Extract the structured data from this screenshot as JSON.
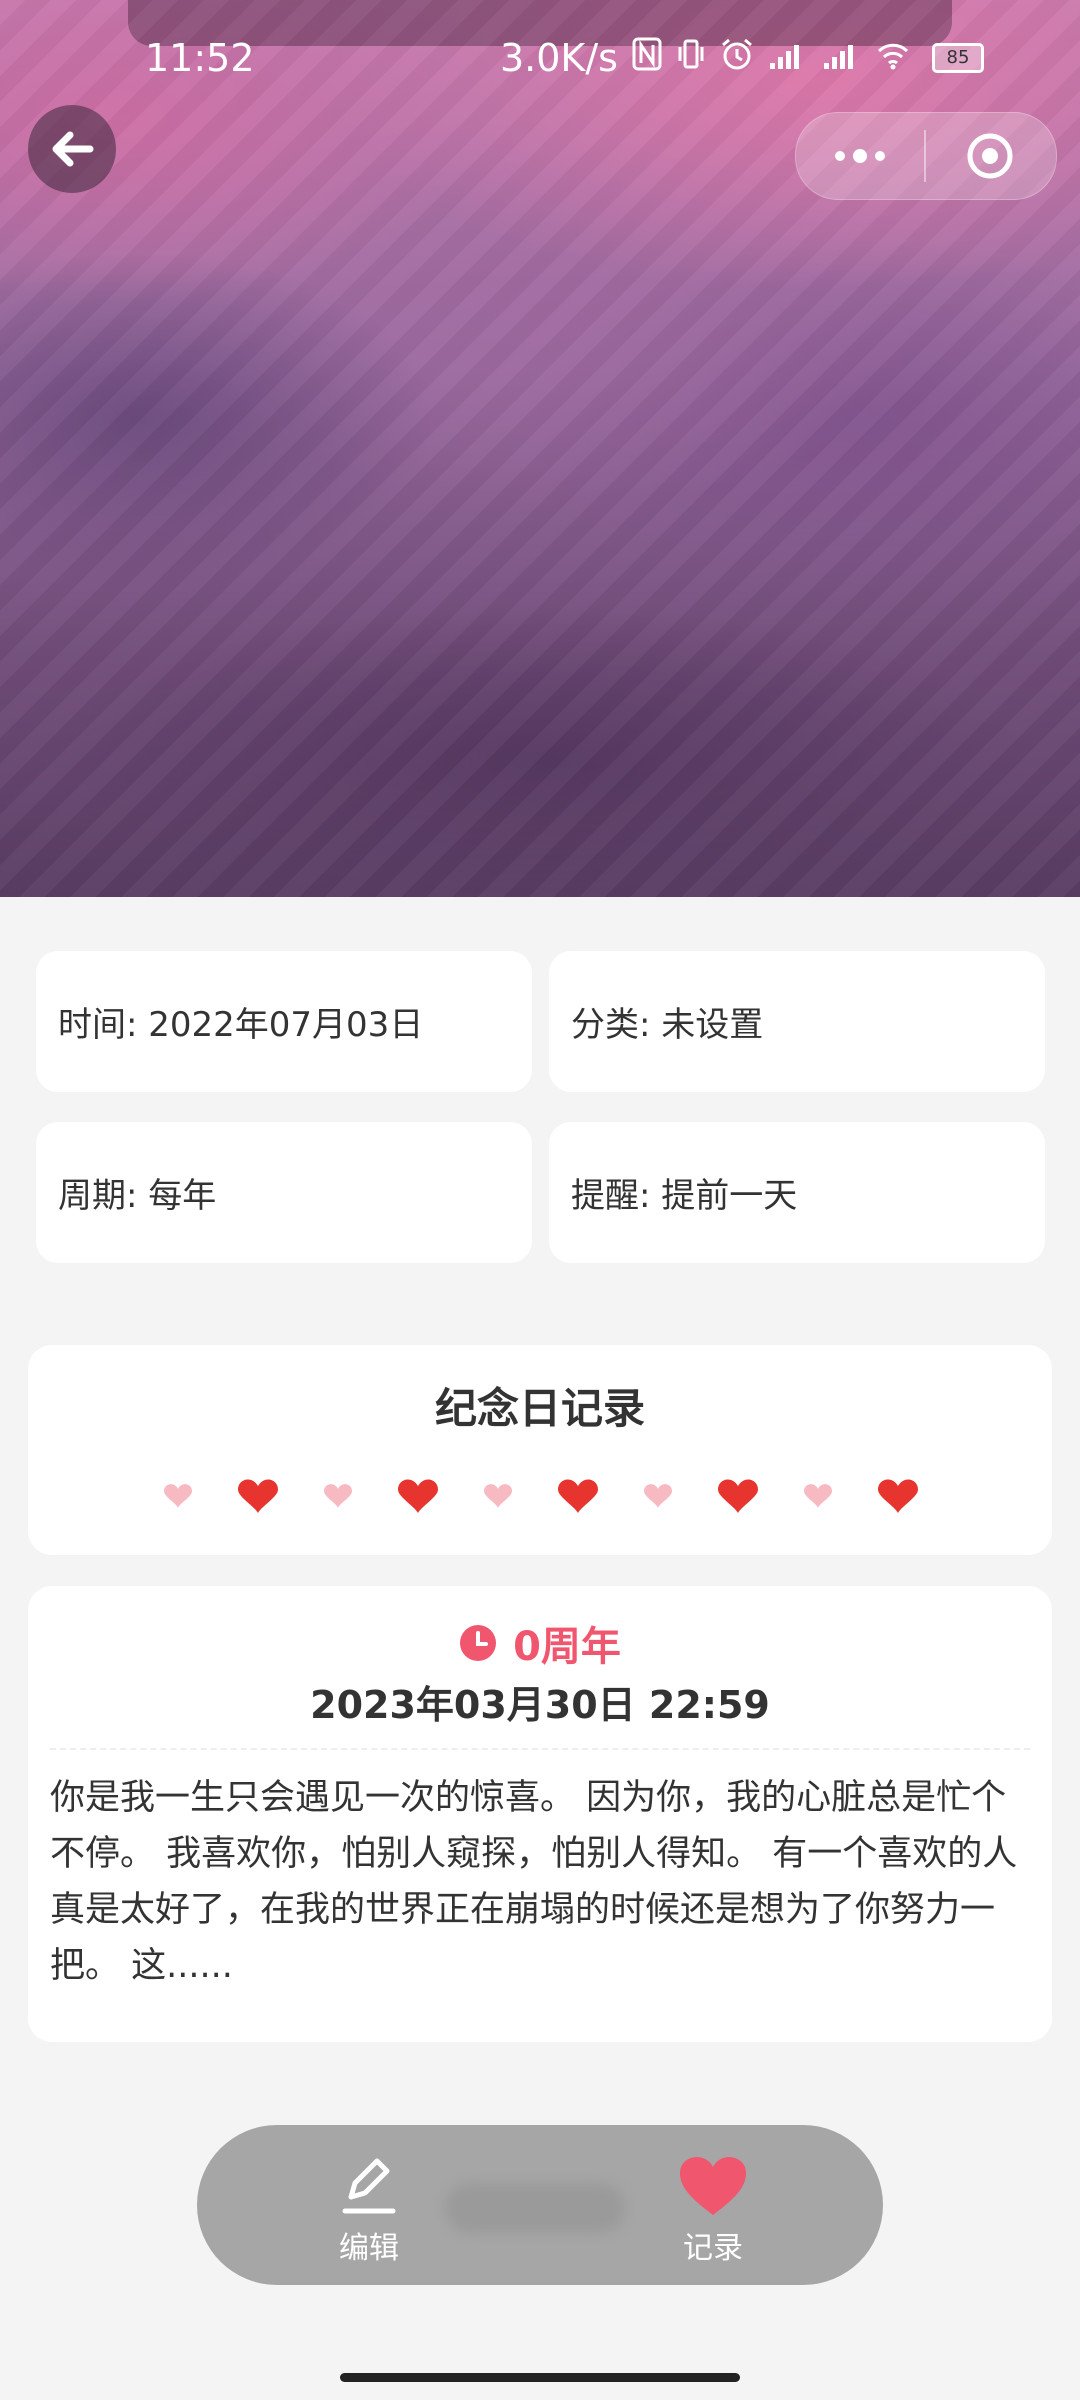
{
  "status_bar": {
    "time": "11:52",
    "net_speed": "3.0K/s",
    "battery": "85"
  },
  "info": {
    "time": "时间: 2022年07月03日",
    "category": "分类: 未设置",
    "cycle": "周期: 每年",
    "reminder": "提醒: 提前一天"
  },
  "records": {
    "title": "纪念日记录",
    "hearts": [
      "light",
      "red",
      "light",
      "red",
      "light",
      "red",
      "light",
      "red",
      "light",
      "red"
    ]
  },
  "entry": {
    "anniversary": "0周年",
    "datetime": "2023年03月30日 22:59",
    "content": "你是我一生只会遇见一次的惊喜。 因为你，我的心脏总是忙个不停。 我喜欢你，怕别人窥探，怕别人得知。 有一个喜欢的人真是太好了，在我的世界正在崩塌的时候还是想为了你努力一把。 这......"
  },
  "bottom_nav": {
    "edit_label": "编辑",
    "record_label": "记录"
  },
  "colors": {
    "accent": "#f0566d",
    "heart_red": "#e8342e",
    "heart_light": "#f7b9c2"
  }
}
